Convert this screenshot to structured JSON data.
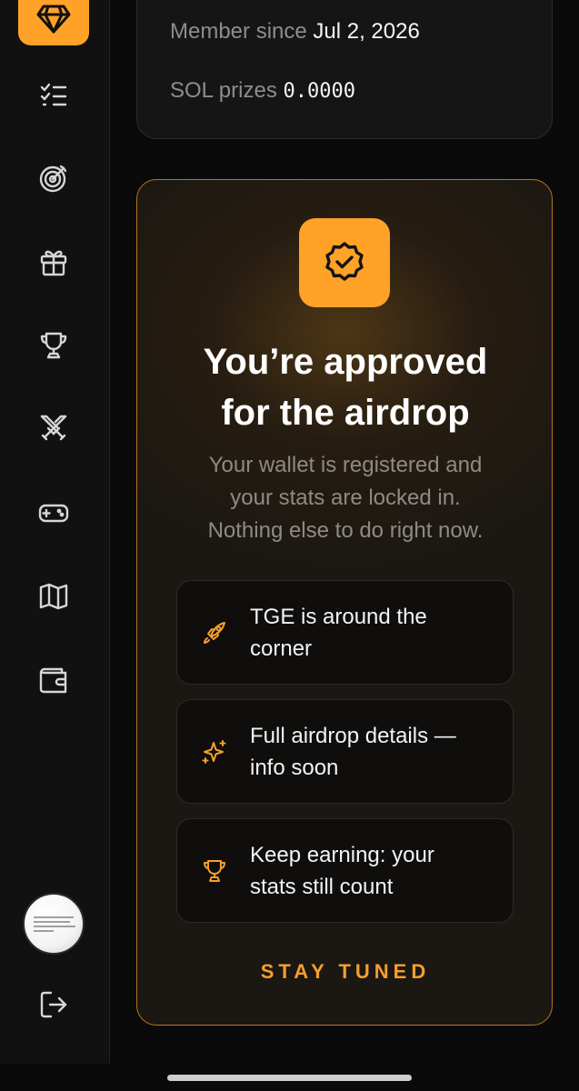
{
  "sidebar": {
    "logo_icon": "diamond-icon",
    "items": [
      {
        "icon": "checklist-icon"
      },
      {
        "icon": "target-icon"
      },
      {
        "icon": "gift-icon"
      },
      {
        "icon": "trophy-icon"
      },
      {
        "icon": "crossed-swords-icon"
      },
      {
        "icon": "gamepad-icon"
      },
      {
        "icon": "map-icon"
      },
      {
        "icon": "wallet-icon"
      }
    ],
    "bottom": {
      "avatar": "avatar",
      "logout_icon": "logout-icon"
    }
  },
  "profile": {
    "member_since_label": "Member since",
    "member_since_value": "Jul 2, 2026",
    "sol_prizes_label": "SOL prizes",
    "sol_prizes_value": "0.0000"
  },
  "airdrop": {
    "badge_icon": "verified-badge-icon",
    "title_line1": "You’re approved",
    "title_line2": "for the airdrop",
    "subtitle_line1": "Your wallet is registered and",
    "subtitle_line2": "your stats are locked in.",
    "subtitle_line3": "Nothing else to do right now.",
    "items": [
      {
        "icon": "rocket-icon",
        "line1": "TGE is around the",
        "line2": "corner"
      },
      {
        "icon": "sparkles-icon",
        "line1": "Full airdrop details —",
        "line2": "info soon"
      },
      {
        "icon": "trophy-icon",
        "line1": "Keep earning: your",
        "line2": "stats still count"
      }
    ],
    "footer": "STAY TUNED"
  },
  "colors": {
    "accent": "#ffa227",
    "background": "#0a0a0a",
    "card_border": "#b9741d"
  }
}
